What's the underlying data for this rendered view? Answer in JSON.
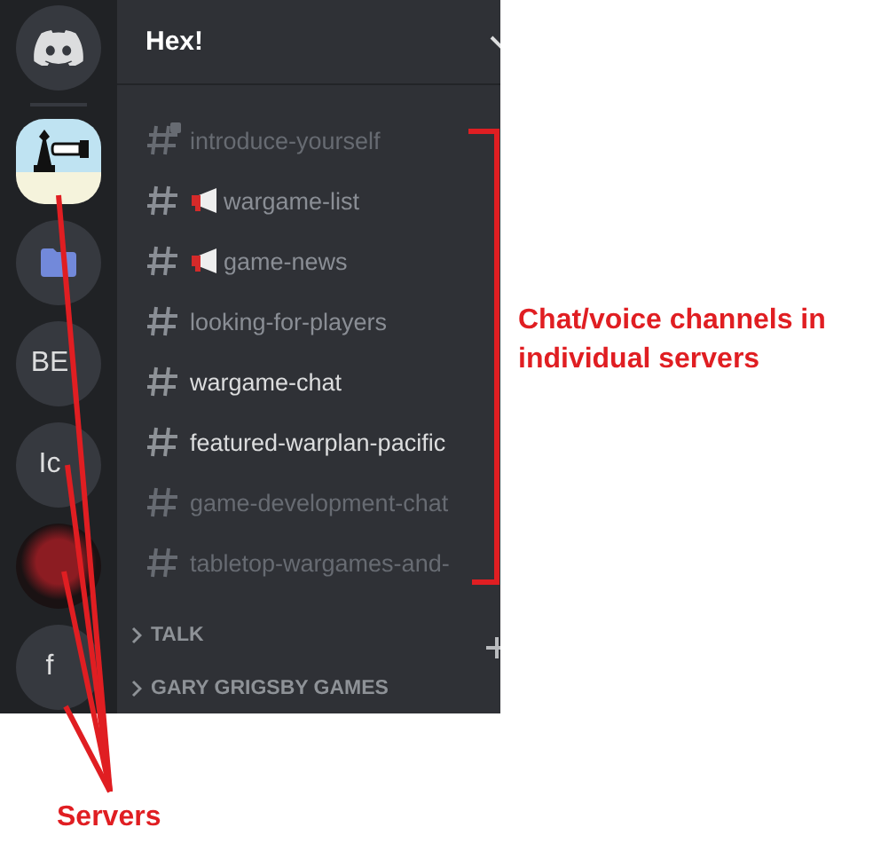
{
  "servers": [
    {
      "kind": "home",
      "selected": false
    },
    {
      "kind": "picture",
      "selected": true
    },
    {
      "kind": "folder",
      "selected": false
    },
    {
      "kind": "text",
      "label": "BE",
      "selected": false
    },
    {
      "kind": "text",
      "label": "Ic",
      "selected": false
    },
    {
      "kind": "photo",
      "selected": false
    },
    {
      "kind": "text",
      "label": "f",
      "selected": false
    }
  ],
  "server_header": {
    "title": "Hex!"
  },
  "channels": [
    {
      "name": "introduce-yourself",
      "locked": true,
      "announcement": false,
      "muted": true,
      "unread": false
    },
    {
      "name": "wargame-list",
      "locked": false,
      "announcement": true,
      "muted": false,
      "unread": false
    },
    {
      "name": "game-news",
      "locked": false,
      "announcement": true,
      "muted": false,
      "unread": false
    },
    {
      "name": "looking-for-players",
      "locked": false,
      "announcement": false,
      "muted": false,
      "unread": false
    },
    {
      "name": "wargame-chat",
      "locked": false,
      "announcement": false,
      "muted": false,
      "unread": true
    },
    {
      "name": "featured-warplan-pacific",
      "locked": false,
      "announcement": false,
      "muted": false,
      "unread": true
    },
    {
      "name": "game-development-chat",
      "locked": false,
      "announcement": false,
      "muted": true,
      "unread": false
    },
    {
      "name": "tabletop-wargames-and-",
      "locked": false,
      "announcement": false,
      "muted": true,
      "unread": false
    }
  ],
  "categories": [
    {
      "name": "TALK",
      "expanded": false
    },
    {
      "name": "GARY GRIGSBY GAMES",
      "expanded": false
    }
  ],
  "annotations": {
    "channels_label": "Chat/voice channels in individual servers",
    "servers_label": "Servers"
  }
}
